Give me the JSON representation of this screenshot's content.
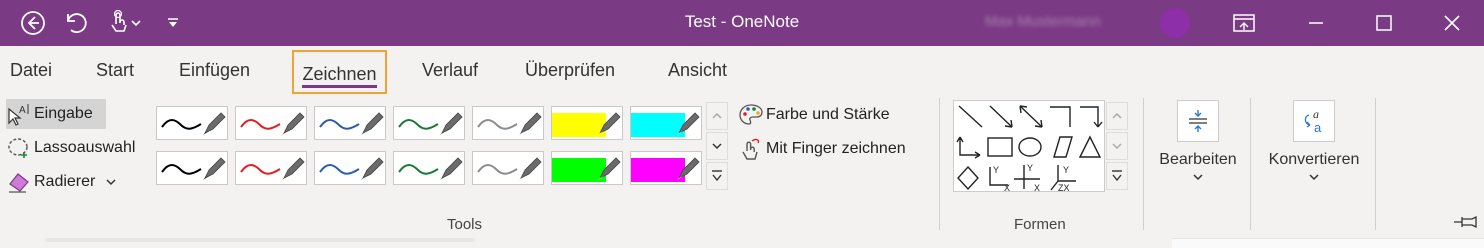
{
  "window": {
    "title": "Test  -  OneNote",
    "user_name": "Max Mustermann",
    "colors": {
      "titlebar": "#7b3a84",
      "accent": "#f0a330"
    }
  },
  "tabs": [
    {
      "label": "Datei"
    },
    {
      "label": "Start"
    },
    {
      "label": "Einfügen"
    },
    {
      "label": "Zeichnen",
      "active": true
    },
    {
      "label": "Verlauf"
    },
    {
      "label": "Überprüfen"
    },
    {
      "label": "Ansicht"
    }
  ],
  "tools": {
    "input_label": "Eingabe",
    "lasso_label": "Lassoauswahl",
    "eraser_label": "Radierer",
    "pens": [
      {
        "color": "#000000",
        "type": "pen"
      },
      {
        "color": "#e02020",
        "type": "pen"
      },
      {
        "color": "#2b5ea8",
        "type": "pen"
      },
      {
        "color": "#1b7a3a",
        "type": "pen"
      },
      {
        "color": "#8c8c8c",
        "type": "pen"
      },
      {
        "color": "#ffff00",
        "type": "highlighter"
      },
      {
        "color": "#00ffff",
        "type": "highlighter"
      },
      {
        "color": "#000000",
        "type": "pen"
      },
      {
        "color": "#e02020",
        "type": "pen"
      },
      {
        "color": "#2b5ea8",
        "type": "pen"
      },
      {
        "color": "#1b7a3a",
        "type": "pen"
      },
      {
        "color": "#8c8c8c",
        "type": "pen"
      },
      {
        "color": "#00ff00",
        "type": "highlighter"
      },
      {
        "color": "#ff00ff",
        "type": "highlighter"
      }
    ],
    "color_strength_label": "Farbe und Stärke",
    "finger_draw_label": "Mit Finger zeichnen",
    "group_label": "Tools"
  },
  "shapes": {
    "group_label": "Formen"
  },
  "edit": {
    "label": "Bearbeiten"
  },
  "convert": {
    "label": "Konvertieren"
  }
}
